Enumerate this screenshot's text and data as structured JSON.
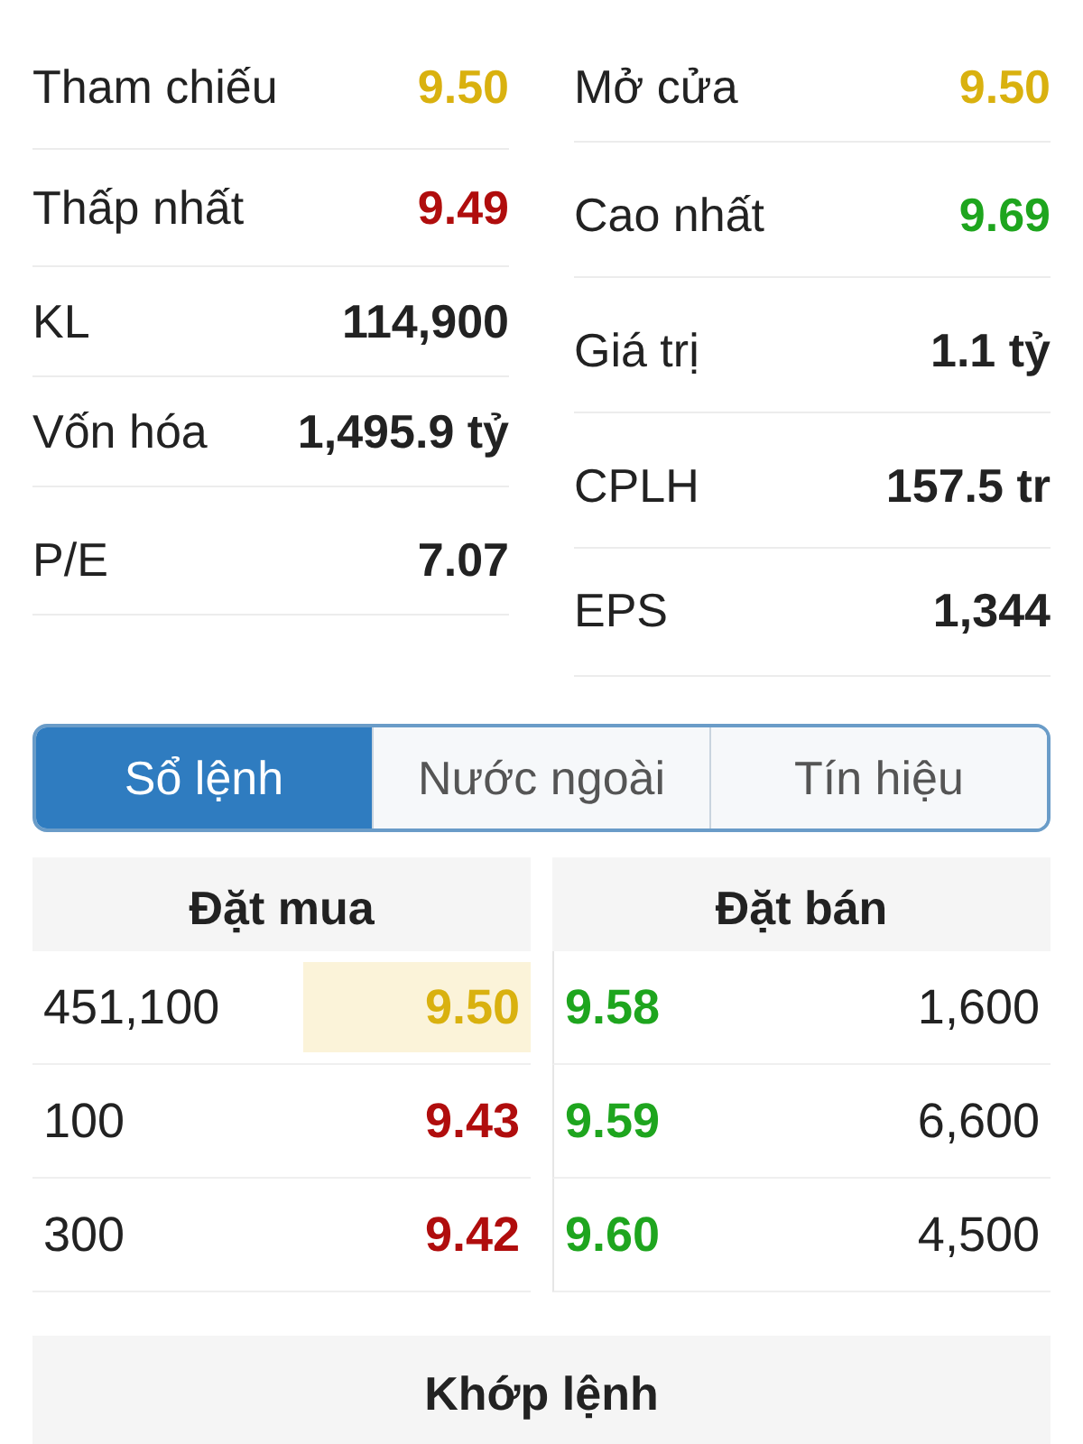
{
  "stats_left": [
    {
      "label": "Tham chiếu",
      "value": "9.50",
      "color": "#d9b10f"
    },
    {
      "label": "Thấp nhất",
      "value": "9.49",
      "color": "#b00d0d"
    },
    {
      "label": "KL",
      "value": "114,900",
      "color": "#222222"
    },
    {
      "label": "Vốn hóa",
      "value": "1,495.9 tỷ",
      "color": "#222222"
    },
    {
      "label": "P/E",
      "value": "7.07",
      "color": "#222222"
    }
  ],
  "stats_right": [
    {
      "label": "Mở cửa",
      "value": "9.50",
      "color": "#d9b10f"
    },
    {
      "label": "Cao nhất",
      "value": "9.69",
      "color": "#1ea51e"
    },
    {
      "label": "Giá trị",
      "value": "1.1 tỷ",
      "color": "#222222"
    },
    {
      "label": "CPLH",
      "value": "157.5 tr",
      "color": "#222222"
    },
    {
      "label": "EPS",
      "value": "1,344",
      "color": "#222222"
    }
  ],
  "tabs": [
    {
      "label": "Sổ lệnh",
      "selected": true
    },
    {
      "label": "Nước ngoài",
      "selected": false
    },
    {
      "label": "Tín hiệu",
      "selected": false
    }
  ],
  "order_book": {
    "bid_title": "Đặt mua",
    "ask_title": "Đặt bán",
    "rows": [
      {
        "bid": {
          "volume": "451,100",
          "price": "9.50",
          "color": "#d9b10f",
          "highlighted": true
        },
        "ask": {
          "price": "9.58",
          "color": "#1ea51e",
          "volume": "1,600"
        }
      },
      {
        "bid": {
          "volume": "100",
          "price": "9.43",
          "color": "#b00d0d",
          "highlighted": false
        },
        "ask": {
          "price": "9.59",
          "color": "#1ea51e",
          "volume": "6,600"
        }
      },
      {
        "bid": {
          "volume": "300",
          "price": "9.42",
          "color": "#b00d0d",
          "highlighted": false
        },
        "ask": {
          "price": "9.60",
          "color": "#1ea51e",
          "volume": "4,500"
        }
      }
    ]
  },
  "matched_title": "Khớp lệnh"
}
